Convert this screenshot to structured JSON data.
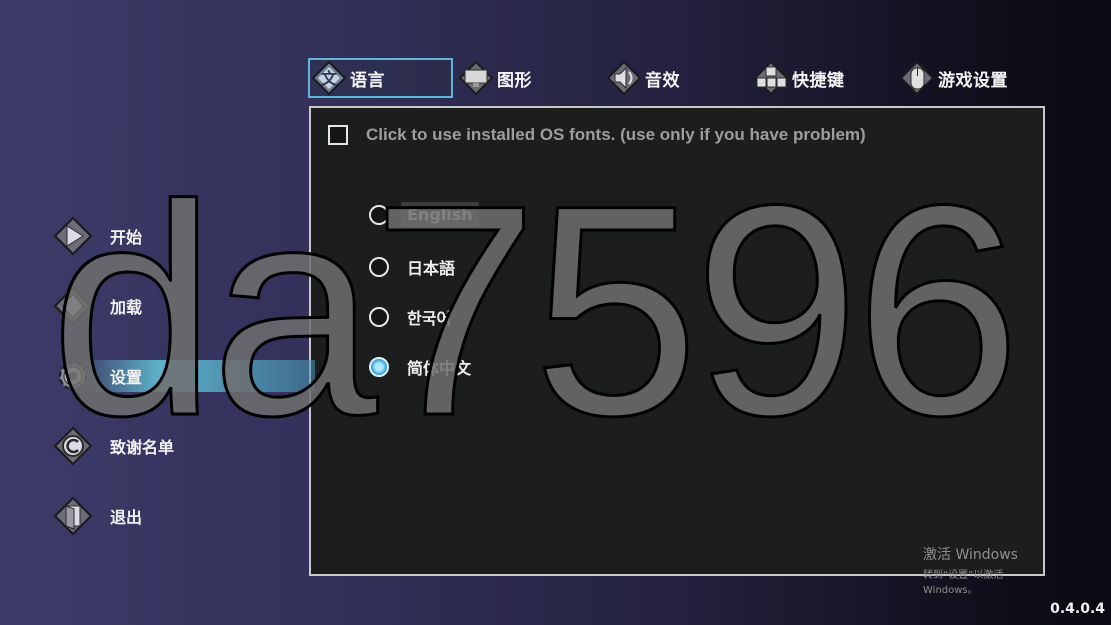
{
  "tabs": [
    {
      "label": "语言",
      "icon": "language-icon",
      "active": true
    },
    {
      "label": "图形",
      "icon": "monitor-icon",
      "active": false
    },
    {
      "label": "音效",
      "icon": "speaker-icon",
      "active": false
    },
    {
      "label": "快捷键",
      "icon": "keyboard-icon",
      "active": false
    },
    {
      "label": "游戏设置",
      "icon": "mouse-icon",
      "active": false
    }
  ],
  "panel": {
    "os_fonts_label": "Click to use installed OS fonts. (use only if you have problem)",
    "os_fonts_checked": false,
    "languages": [
      {
        "label": "English",
        "selected": false
      },
      {
        "label": "日本語",
        "selected": false
      },
      {
        "label": "한국어",
        "selected": false
      },
      {
        "label": "简体中文",
        "selected": true
      }
    ]
  },
  "menu": [
    {
      "label": "开始",
      "icon": "play-icon"
    },
    {
      "label": "加载",
      "icon": "load-icon"
    },
    {
      "label": "设置",
      "icon": "gear-icon",
      "selected": true
    },
    {
      "label": "致谢名单",
      "icon": "copyright-icon"
    },
    {
      "label": "退出",
      "icon": "exit-door-icon"
    }
  ],
  "windows_activation": {
    "line1": "激活 Windows",
    "line2": "转到“设置”以激活 Windows。"
  },
  "version": "0.4.0.4",
  "watermark": "da7596",
  "colors": {
    "accent": "#5fb6d8",
    "panel_bg": "#1c1e1e",
    "panel_border": "#c8c8c8"
  }
}
